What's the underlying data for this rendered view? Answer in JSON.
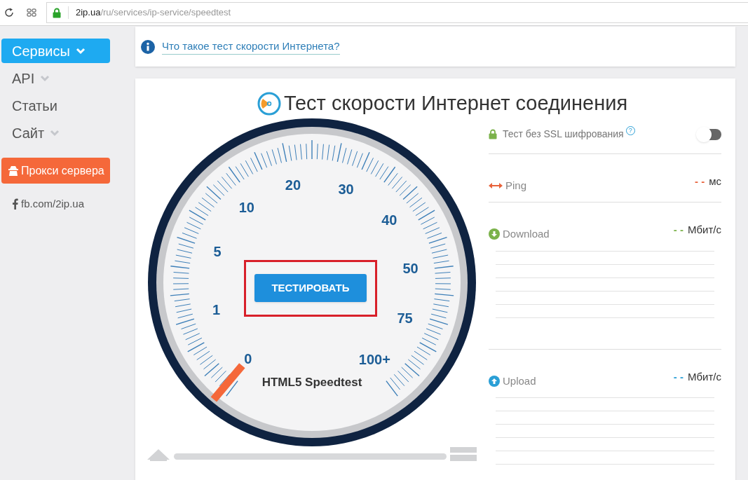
{
  "browser": {
    "url_host": "2ip.ua",
    "url_path": "/ru/services/ip-service/speedtest"
  },
  "sidebar": {
    "items": [
      {
        "label": "Сервисы",
        "selected": true,
        "has_submenu": true
      },
      {
        "label": "API",
        "selected": false,
        "has_submenu": true
      },
      {
        "label": "Статьи",
        "selected": false,
        "has_submenu": false
      },
      {
        "label": "Сайт",
        "selected": false,
        "has_submenu": true
      }
    ],
    "proxy_button": "Прокси сервера",
    "social_link": "fb.com/2ip.ua"
  },
  "info_link": "Что такое тест скорости Интернета?",
  "speedtest": {
    "title": "Тест скорости Интернет соединения",
    "scale": [
      "0",
      "1",
      "5",
      "10",
      "20",
      "30",
      "40",
      "50",
      "75",
      "100+"
    ],
    "start_button": "ТЕСТИРОВАТЬ",
    "button_highlighted": true,
    "caption": "HTML5 Speedtest",
    "progress": {
      "level": 0
    }
  },
  "ssl_option": {
    "label": "Тест без SSL шифрования",
    "help": "?",
    "on": false
  },
  "metrics": [
    {
      "kind": "ping",
      "label": "Ping",
      "value": "- -",
      "unit": "мс",
      "color": "#e8623a",
      "graph": false
    },
    {
      "kind": "download",
      "label": "Download",
      "value": "- -",
      "unit": "Мбит/с",
      "color": "#7bb24a",
      "graph": true
    },
    {
      "kind": "upload",
      "label": "Upload",
      "value": "- -",
      "unit": "Мбит/с",
      "color": "#2a9fd6",
      "graph": true
    }
  ]
}
